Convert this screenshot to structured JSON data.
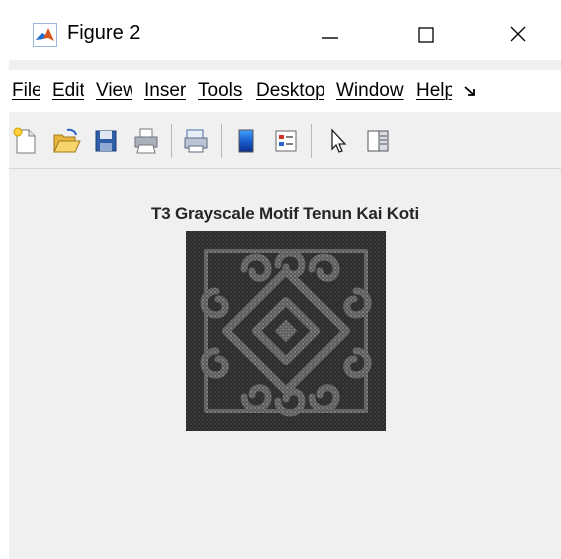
{
  "window": {
    "title": "Figure 2",
    "controls": {
      "minimize": "—",
      "maximize": "☐",
      "close": "✕"
    }
  },
  "menu": {
    "items": [
      "File",
      "Edit",
      "View",
      "Insert",
      "Tools",
      "Desktop",
      "Window",
      "Help"
    ],
    "overflow_icon": "chevron-overflow-icon"
  },
  "toolbar": {
    "buttons": [
      "new-figure-icon",
      "open-file-icon",
      "save-icon",
      "print-icon",
      "link-plot-icon",
      "colorbar-icon",
      "legend-icon",
      "pointer-icon",
      "property-inspector-icon"
    ]
  },
  "figure": {
    "title": "T3 Grayscale Motif Tenun Kai Koti"
  },
  "colors": {
    "window_bg": "#f0f0f0",
    "titlebar_bg": "#ffffff",
    "accent_matlab": "#d9541e",
    "accent_blue": "#1c6fd6"
  }
}
